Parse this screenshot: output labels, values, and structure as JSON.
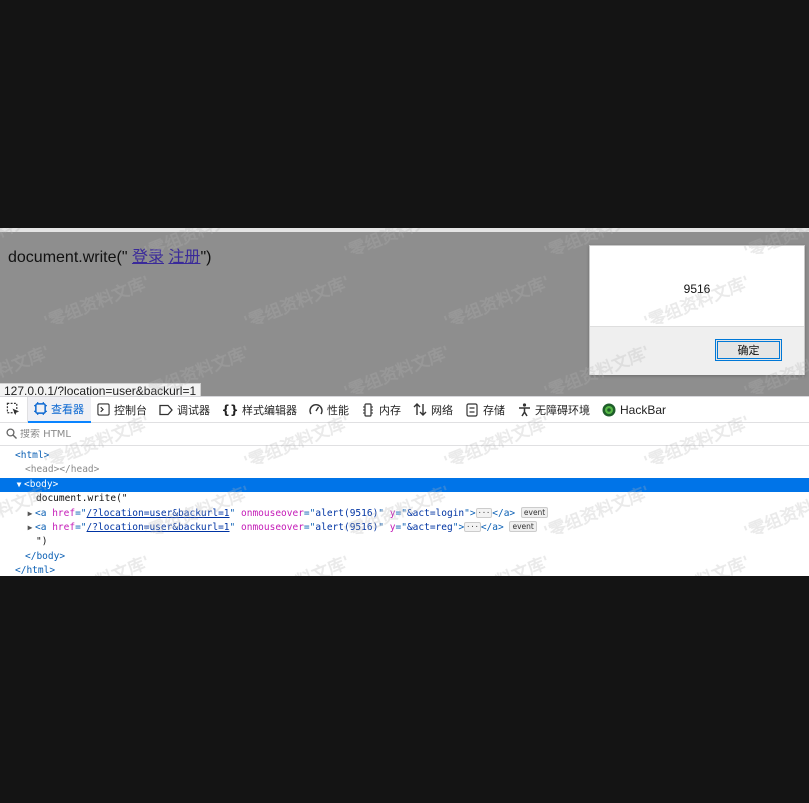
{
  "page": {
    "text_prefix": "document.write(\" ",
    "link_login": "登录",
    "link_register": "注册",
    "text_suffix": "\")"
  },
  "alert": {
    "message": "9516",
    "ok_label": "确定"
  },
  "status_bar": {
    "url": "127.0.0.1/?location=user&backurl=1"
  },
  "devtools": {
    "tabs": [
      {
        "label": "查看器",
        "icon": "inspector-icon",
        "selected": true
      },
      {
        "label": "控制台",
        "icon": "console-icon"
      },
      {
        "label": "调试器",
        "icon": "debugger-icon"
      },
      {
        "label": "样式编辑器",
        "icon": "style-editor-icon"
      },
      {
        "label": "性能",
        "icon": "performance-icon"
      },
      {
        "label": "内存",
        "icon": "memory-icon"
      },
      {
        "label": "网络",
        "icon": "network-icon"
      },
      {
        "label": "存储",
        "icon": "storage-icon"
      },
      {
        "label": "无障碍环境",
        "icon": "accessibility-icon"
      },
      {
        "label": "HackBar",
        "icon": "hackbar-icon"
      }
    ],
    "search_placeholder": "搜索 HTML",
    "tree": {
      "html_open": "<html>",
      "head": "<head></head>",
      "body_open": "<body>",
      "text_node": "document.write(\"",
      "link1": {
        "tag": "<a",
        "href_attr": "href",
        "href_value": "/?location=user&backurl=1",
        "event_attr": "onmouseover",
        "event_value": "alert(9516)",
        "y_attr": "y",
        "y_value": "&act=login",
        "close": "</a>",
        "badge": "event"
      },
      "link2": {
        "tag": "<a",
        "href_attr": "href",
        "href_value": "/?location=user&backurl=1",
        "event_attr": "onmouseover",
        "event_value": "alert(9516)",
        "y_attr": "y",
        "y_value": "&act=reg",
        "close": "</a>",
        "badge": "event"
      },
      "text_end": "\")",
      "body_close": "</body>",
      "html_close": "</html>"
    }
  },
  "watermark": "零组资料文库"
}
